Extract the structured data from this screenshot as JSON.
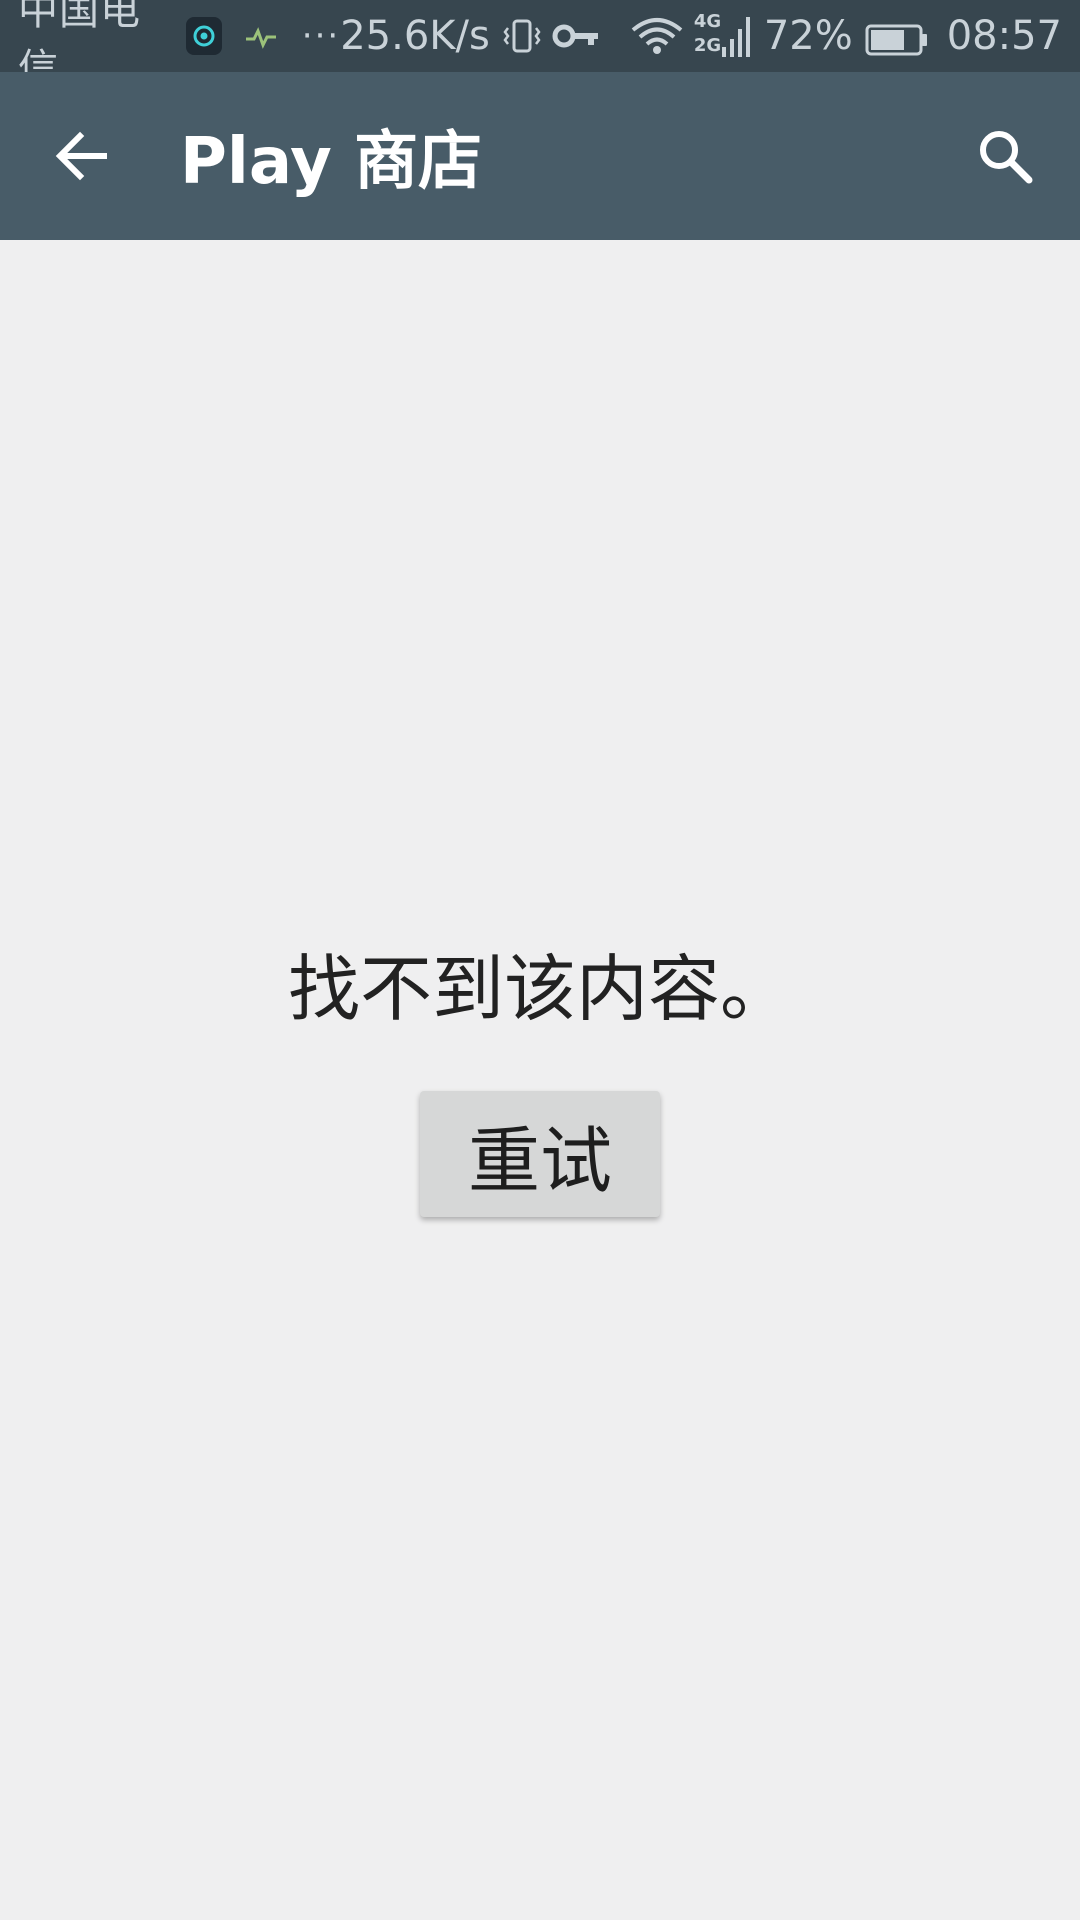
{
  "status_bar": {
    "carrier": "中国电信",
    "more": "···",
    "net_speed": "25.6K/s",
    "network_top": "4G",
    "network_bottom": "2G",
    "battery_percent": "72%",
    "battery_level": 0.72,
    "time": "08:57",
    "icons": [
      "app-notification-icon",
      "app-notification-icon-2",
      "vibrate-icon",
      "vpn-key-icon",
      "wifi-icon",
      "signal-icon",
      "battery-icon"
    ]
  },
  "app_bar": {
    "title": "Play 商店",
    "back_icon": "arrow-back-icon",
    "search_icon": "search-icon",
    "background": "#485c68"
  },
  "content": {
    "message": "找不到该内容。",
    "retry_label": "重试"
  },
  "colors": {
    "status_bar_bg": "#37464f",
    "page_bg": "#efeff0",
    "button_bg": "#d6d7d7"
  }
}
